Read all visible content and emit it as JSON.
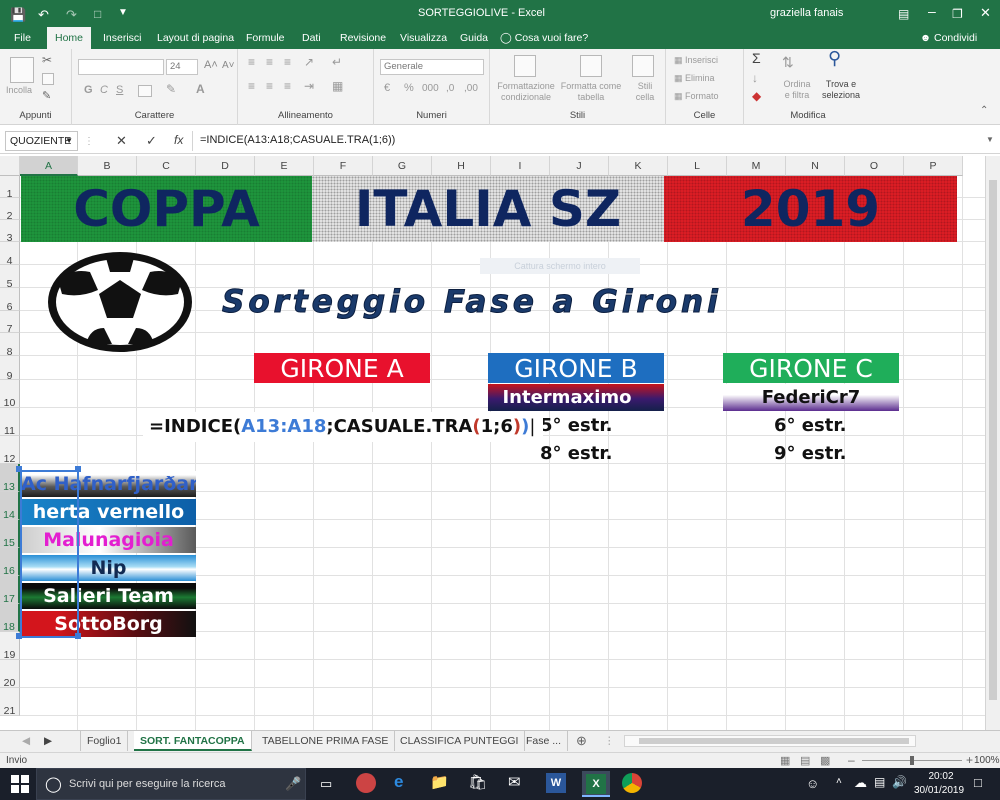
{
  "window": {
    "title": "SORTEGGIOLIVE  -  Excel",
    "user": "graziella fanais",
    "share": "Condividi"
  },
  "ribbon_tabs": [
    "File",
    "Home",
    "Inserisci",
    "Layout di pagina",
    "Formule",
    "Dati",
    "Revisione",
    "Visualizza",
    "Guida",
    "Cosa vuoi fare?"
  ],
  "ribbon": {
    "clipboard": {
      "label": "Appunti",
      "paste": "Incolla"
    },
    "font": {
      "label": "Carattere",
      "size": "24",
      "bold": "G",
      "italic": "C",
      "underline": "S"
    },
    "alignment": {
      "label": "Allineamento"
    },
    "number": {
      "label": "Numeri",
      "format": "Generale"
    },
    "styles": {
      "label": "Stili",
      "cond": "Formattazione condizionale",
      "table": "Formatta come tabella",
      "cell": "Stili cella"
    },
    "cells": {
      "label": "Celle",
      "insert": "Inserisci",
      "delete": "Elimina",
      "format": "Formato"
    },
    "edit": {
      "label": "Modifica",
      "sort": "Ordina e filtra",
      "find": "Trova e seleziona"
    }
  },
  "formula_bar": {
    "namebox": "QUOZIENTE",
    "formula": "=INDICE(A13:A18;CASUALE.TRA(1;6))"
  },
  "columns": [
    "A",
    "B",
    "C",
    "D",
    "E",
    "F",
    "G",
    "H",
    "I",
    "J",
    "K",
    "L",
    "M",
    "N",
    "O",
    "P"
  ],
  "rows": [
    "1",
    "2",
    "3",
    "4",
    "5",
    "6",
    "7",
    "8",
    "9",
    "10",
    "11",
    "12",
    "13",
    "14",
    "15",
    "16",
    "17",
    "18",
    "19",
    "20",
    "21"
  ],
  "banner": {
    "part1": "COPPA",
    "part2": "ITALIA SZ",
    "part3": "2019"
  },
  "subtitle": "Sorteggio Fase a Gironi",
  "faded_overlay": "Cattura schermo intero",
  "groups": {
    "a": {
      "title": "GIRONE A"
    },
    "b": {
      "title": "GIRONE B",
      "team": "Intermaximo",
      "estr1": "5° estr.",
      "estr2": "8° estr."
    },
    "c": {
      "title": "GIRONE C",
      "team": "FederiCr7",
      "estr1": "6° estr.",
      "estr2": "9° estr."
    }
  },
  "edit_cell": {
    "prefix": "=INDICE(",
    "ref": "A13:A18",
    "mid": ";CASUALE.TRA",
    "open": "(",
    "args": "1;6",
    "close": ")",
    "end": ")"
  },
  "teams": [
    "Ac Hafnarfjarðar",
    "herta vernello",
    "Malunagioia",
    "Nip",
    "Salieri Team",
    "SottoBorg"
  ],
  "sheets": [
    "Foglio1",
    "SORT. FANTACOPPA",
    "TABELLONE PRIMA FASE",
    "CLASSIFICA PUNTEGGI",
    "Fase ..."
  ],
  "status": {
    "mode": "Invio",
    "zoom": "100%"
  },
  "taskbar": {
    "search": "Scrivi qui per eseguire la ricerca",
    "time": "20:02",
    "date": "30/01/2019"
  },
  "colors": {
    "excel_green": "#217346",
    "navy": "#0f2660",
    "girone_a": "#e8112d",
    "girone_b": "#1e6ec0",
    "girone_c": "#1fae5a"
  }
}
